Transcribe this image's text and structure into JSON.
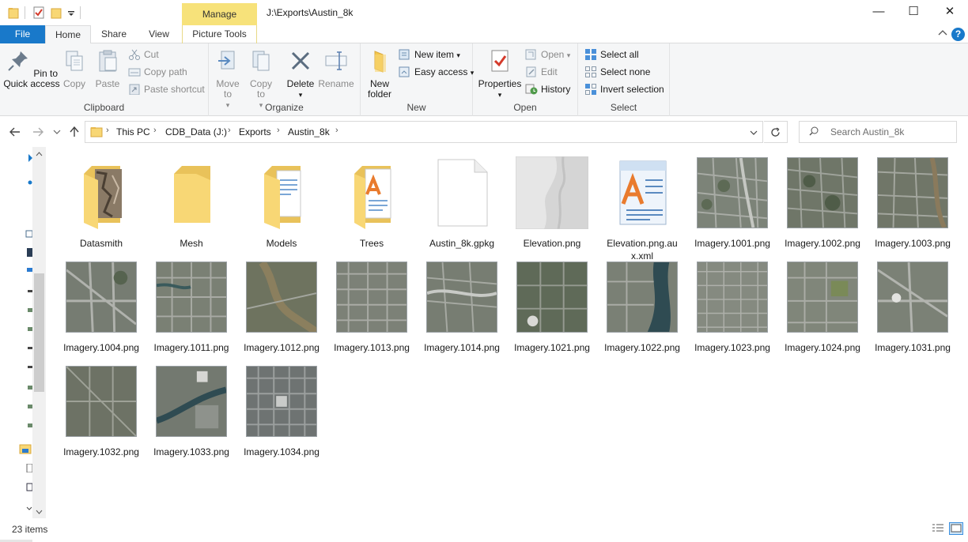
{
  "window": {
    "title": "J:\\Exports\\Austin_8k",
    "contextual_tab": "Manage",
    "minimize": "—",
    "maximize": "☐",
    "close": "✕"
  },
  "tabs": {
    "file": "File",
    "home": "Home",
    "share": "Share",
    "view": "View",
    "picture_tools": "Picture Tools",
    "help": "?"
  },
  "ribbon": {
    "clipboard": {
      "label": "Clipboard",
      "pin": "Pin to Quick access",
      "copy": "Copy",
      "paste": "Paste",
      "cut": "Cut",
      "copy_path": "Copy path",
      "paste_shortcut": "Paste shortcut"
    },
    "organize": {
      "label": "Organize",
      "move_to": "Move to",
      "copy_to": "Copy to",
      "delete": "Delete",
      "rename": "Rename"
    },
    "new": {
      "label": "New",
      "new_folder": "New folder",
      "new_item": "New item",
      "easy_access": "Easy access"
    },
    "open": {
      "label": "Open",
      "properties": "Properties",
      "open": "Open",
      "edit": "Edit",
      "history": "History"
    },
    "select": {
      "label": "Select",
      "select_all": "Select all",
      "select_none": "Select none",
      "invert_selection": "Invert selection"
    }
  },
  "address": {
    "crumbs": [
      "This PC",
      "CDB_Data (J:)",
      "Exports",
      "Austin_8k"
    ],
    "search_placeholder": "Search Austin_8k"
  },
  "items": [
    {
      "name": "Datasmith",
      "type": "folder"
    },
    {
      "name": "Mesh",
      "type": "folder"
    },
    {
      "name": "Models",
      "type": "folder"
    },
    {
      "name": "Trees",
      "type": "folder"
    },
    {
      "name": "Austin_8k.gpkg",
      "type": "file"
    },
    {
      "name": "Elevation.png",
      "type": "image"
    },
    {
      "name": "Elevation.png.aux.xml",
      "type": "xml"
    },
    {
      "name": "Imagery.1001.png",
      "type": "image"
    },
    {
      "name": "Imagery.1002.png",
      "type": "image"
    },
    {
      "name": "Imagery.1003.png",
      "type": "image"
    },
    {
      "name": "Imagery.1004.png",
      "type": "image"
    },
    {
      "name": "Imagery.1011.png",
      "type": "image"
    },
    {
      "name": "Imagery.1012.png",
      "type": "image"
    },
    {
      "name": "Imagery.1013.png",
      "type": "image"
    },
    {
      "name": "Imagery.1014.png",
      "type": "image"
    },
    {
      "name": "Imagery.1021.png",
      "type": "image"
    },
    {
      "name": "Imagery.1022.png",
      "type": "image"
    },
    {
      "name": "Imagery.1023.png",
      "type": "image"
    },
    {
      "name": "Imagery.1024.png",
      "type": "image"
    },
    {
      "name": "Imagery.1031.png",
      "type": "image"
    },
    {
      "name": "Imagery.1032.png",
      "type": "image"
    },
    {
      "name": "Imagery.1033.png",
      "type": "image"
    },
    {
      "name": "Imagery.1034.png",
      "type": "image"
    }
  ],
  "status": {
    "count": "23 items"
  },
  "colors": {
    "accent": "#1979ca",
    "manage_tab": "#f7e27a",
    "folder": "#f8d775"
  }
}
